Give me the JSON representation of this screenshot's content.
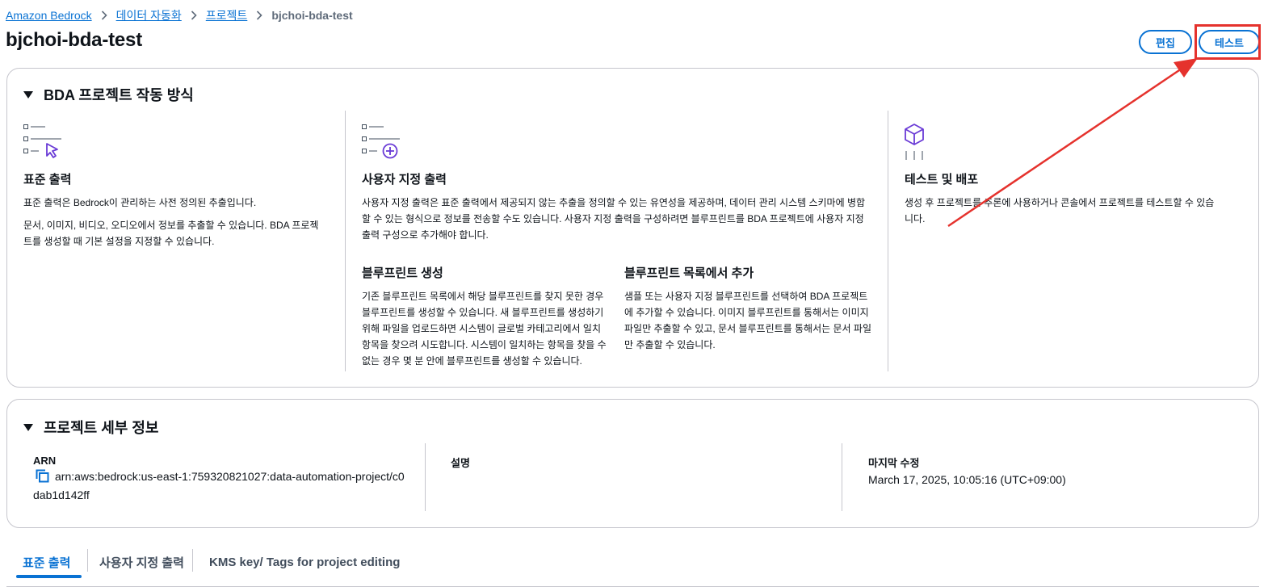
{
  "breadcrumb": {
    "items": [
      "Amazon Bedrock",
      "데이터 자동화",
      "프로젝트"
    ],
    "current": "bjchoi-bda-test"
  },
  "page_title": "bjchoi-bda-test",
  "actions": {
    "edit_label": "편집",
    "test_label": "테스트"
  },
  "how_it_works": {
    "header": "BDA 프로젝트 작동 방식",
    "standard": {
      "title": "표준 출력",
      "p1": "표준 출력은 Bedrock이 관리하는 사전 정의된 추출입니다.",
      "p2": "문서, 이미지, 비디오, 오디오에서 정보를 추출할 수 있습니다. BDA 프로젝트를 생성할 때 기본 설정을 지정할 수 있습니다."
    },
    "custom": {
      "title": "사용자 지정 출력",
      "desc": "사용자 지정 출력은 표준 출력에서 제공되지 않는 추출을 정의할 수 있는 유연성을 제공하며, 데이터 관리 시스템 스키마에 병합할 수 있는 형식으로 정보를 전송할 수도 있습니다. 사용자 지정 출력을 구성하려면 블루프린트를 BDA 프로젝트에 사용자 지정 출력 구성으로 추가해야 합니다.",
      "create": {
        "title": "블루프린트 생성",
        "desc": "기존 블루프린트 목록에서 해당 블루프린트를 찾지 못한 경우 블루프린트를 생성할 수 있습니다. 새 블루프린트를 생성하기 위해 파일을 업로드하면 시스템이 글로벌 카테고리에서 일치 항목을 찾으려 시도합니다. 시스템이 일치하는 항목을 찾을 수 없는 경우 몇 분 안에 블루프린트를 생성할 수 있습니다."
      },
      "add": {
        "title": "블루프린트 목록에서 추가",
        "desc": "샘플 또는 사용자 지정 블루프린트를 선택하여 BDA 프로젝트에 추가할 수 있습니다. 이미지 블루프린트를 통해서는 이미지 파일만 추출할 수 있고, 문서 블루프린트를 통해서는 문서 파일만 추출할 수 있습니다."
      }
    },
    "test_deploy": {
      "title": "테스트 및 배포",
      "desc": "생성 후 프로젝트를 추론에 사용하거나 콘솔에서 프로젝트를 테스트할 수 있습니다."
    }
  },
  "details": {
    "header": "프로젝트 세부 정보",
    "arn_label": "ARN",
    "arn_value": "arn:aws:bedrock:us-east-1:759320821027:data-automation-project/c0dab1d142ff",
    "desc_label": "설명",
    "modified_label": "마지막 수정",
    "modified_value": "March 17, 2025, 10:05:16 (UTC+09:00)"
  },
  "tabs": [
    "표준 출력",
    "사용자 지정 출력",
    "KMS key/ Tags for project editing"
  ],
  "colors": {
    "accent": "#0972d3",
    "annotation": "#e5322d",
    "icon_purple": "#6a3bd6"
  },
  "icons": {
    "standard": "list-cursor-icon",
    "custom": "list-plus-icon",
    "test_deploy": "cube-icon",
    "copy": "copy-icon"
  }
}
